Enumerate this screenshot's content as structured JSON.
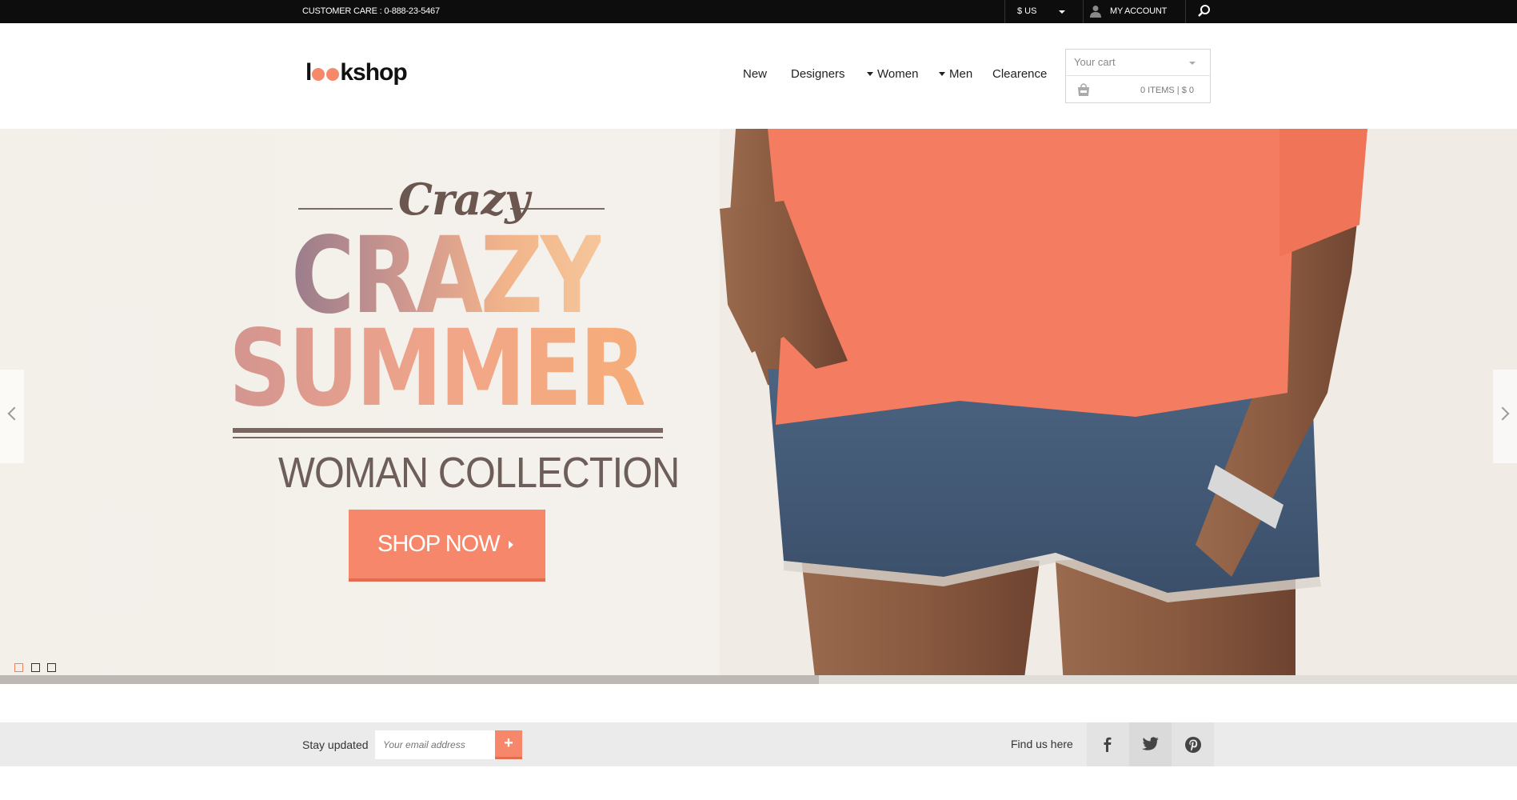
{
  "topbar": {
    "customer_care": "CUSTOMER CARE : 0-888-23-5467",
    "currency": "$ US",
    "account": "MY ACCOUNT",
    "icons": [
      "user-icon",
      "search-icon"
    ]
  },
  "header": {
    "logo": {
      "before": "l",
      "after": "kshop",
      "dot_color": "#f6896a"
    },
    "nav": [
      {
        "label": "New",
        "has_dropdown": false
      },
      {
        "label": "Designers",
        "has_dropdown": false
      },
      {
        "label": "Women",
        "has_dropdown": true
      },
      {
        "label": "Men",
        "has_dropdown": true
      },
      {
        "label": "Clearence",
        "has_dropdown": false
      }
    ],
    "cart": {
      "label": "Your cart",
      "summary": "0 ITEMS | $ 0"
    }
  },
  "hero": {
    "script": "Crazy",
    "line1": "CRAZY",
    "line2": "SUMMER",
    "subtitle": "WOMAN COLLECTION",
    "cta": "SHOP NOW",
    "slides": 3,
    "active_slide": 0,
    "progress": 0.54,
    "accent": "#f7876a"
  },
  "footer": {
    "stay_updated": "Stay updated",
    "email_placeholder": "Your email address",
    "submit": "+",
    "find_us": "Find us here",
    "social": [
      "facebook-icon",
      "twitter-icon",
      "pinterest-icon"
    ]
  }
}
